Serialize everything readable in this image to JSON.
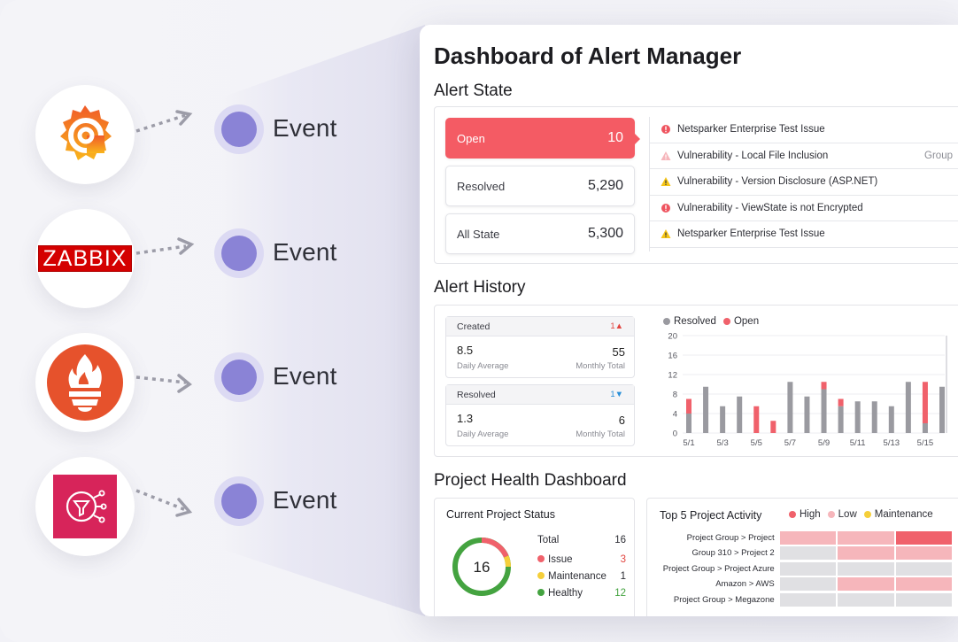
{
  "sources": [
    {
      "name": "Grafana",
      "event_label": "Event"
    },
    {
      "name": "Zabbix",
      "logo_text": "ZABBIX",
      "event_label": "Event"
    },
    {
      "name": "Prometheus",
      "event_label": "Event"
    },
    {
      "name": "AWS SNS",
      "event_label": "Event"
    }
  ],
  "dashboard": {
    "title": "Dashboard of Alert Manager",
    "alert_state": {
      "title": "Alert State",
      "states": [
        {
          "label": "Open",
          "count": "10"
        },
        {
          "label": "Resolved",
          "count": "5,290"
        },
        {
          "label": "All State",
          "count": "5,300"
        }
      ],
      "alerts": [
        {
          "text": "Netsparker Enterprise Test Issue",
          "severity": "error-icon",
          "extra": ""
        },
        {
          "text": "Vulnerability - Local File Inclusion",
          "severity": "warning-light-icon",
          "extra": "Group"
        },
        {
          "text": "Vulnerability - Version Disclosure (ASP.NET)",
          "severity": "warning-icon",
          "extra": ""
        },
        {
          "text": "Vulnerability - ViewState is not Encrypted",
          "severity": "error-icon",
          "extra": ""
        },
        {
          "text": "Netsparker Enterprise Test Issue",
          "severity": "warning-icon",
          "extra": ""
        }
      ]
    },
    "alert_history": {
      "title": "Alert History",
      "created": {
        "label": "Created",
        "trend": "1▲",
        "daily": "8.5",
        "daily_label": "Daily Average",
        "monthly": "55",
        "monthly_label": "Monthly Total"
      },
      "resolved": {
        "label": "Resolved",
        "trend": "1▼",
        "daily": "1.3",
        "daily_label": "Daily Average",
        "monthly": "6",
        "monthly_label": "Monthly Total"
      },
      "legend": {
        "resolved": "Resolved",
        "open": "Open"
      }
    },
    "project_health": {
      "title": "Project Health Dashboard",
      "current_status": {
        "title": "Current Project Status",
        "center_value": "16",
        "total_label": "Total",
        "total_value": "16",
        "rows": [
          {
            "label": "Issue",
            "value": "3",
            "color": "#f0616b"
          },
          {
            "label": "Maintenance",
            "value": "1",
            "color": "#f5cf3a"
          },
          {
            "label": "Healthy",
            "value": "12",
            "color": "#44a340"
          }
        ]
      },
      "top5": {
        "title": "Top 5 Project Activity",
        "legend": [
          {
            "label": "High",
            "color": "#f0616b"
          },
          {
            "label": "Low",
            "color": "#f6b6bb"
          },
          {
            "label": "Maintenance",
            "color": "#f5cf3a"
          }
        ],
        "rows": [
          {
            "label": "Project Group > Project",
            "cells": [
              "low",
              "low",
              "high"
            ]
          },
          {
            "label": "Group 310 > Project 2",
            "cells": [
              "none",
              "low",
              "low"
            ]
          },
          {
            "label": "Project Group > Project Azure",
            "cells": [
              "none",
              "none",
              "none"
            ]
          },
          {
            "label": "Amazon > AWS",
            "cells": [
              "none",
              "low",
              "low"
            ]
          },
          {
            "label": "Project Group > Megazone",
            "cells": [
              "none",
              "none",
              "none"
            ]
          }
        ]
      }
    }
  },
  "chart_data": {
    "type": "bar",
    "stacked": true,
    "x": [
      "5/1",
      "5/2",
      "5/3",
      "5/4",
      "5/5",
      "5/6",
      "5/7",
      "5/8",
      "5/9",
      "5/10",
      "5/11",
      "5/12",
      "5/13",
      "5/14",
      "5/15",
      "5/16"
    ],
    "tick_labels": [
      "5/1",
      "5/3",
      "5/5",
      "5/7",
      "5/9",
      "5/11",
      "5/13",
      "5/15"
    ],
    "series": [
      {
        "name": "Resolved",
        "color": "#9a9aa0",
        "values": [
          4,
          9.5,
          5.5,
          7.5,
          0,
          0,
          10.5,
          7.5,
          9,
          5.5,
          6.5,
          6.5,
          5.5,
          10.5,
          2,
          9.5
        ]
      },
      {
        "name": "Open",
        "color": "#f0616b",
        "values": [
          3,
          0,
          0,
          0,
          5.5,
          2.5,
          0,
          0,
          1.5,
          1.5,
          0,
          0,
          0,
          0,
          8.5,
          0
        ]
      }
    ],
    "ylim": [
      0,
      20
    ],
    "yticks": [
      0,
      4,
      8,
      12,
      16,
      20
    ],
    "grid": true,
    "legend": "top-left"
  }
}
